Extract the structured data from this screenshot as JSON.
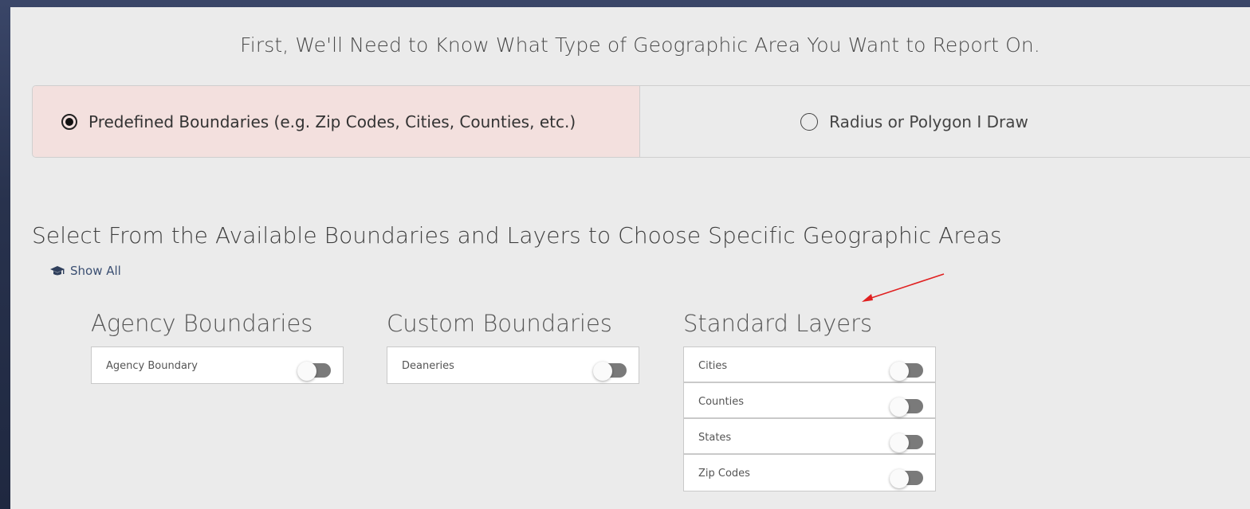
{
  "heading": "First, We'll Need to Know What Type of Geographic Area You Want to Report On.",
  "area_type": {
    "options": [
      {
        "label": "Predefined Boundaries (e.g. Zip Codes, Cities, Counties, etc.)",
        "selected": true
      },
      {
        "label": "Radius or Polygon I Draw",
        "selected": false
      }
    ]
  },
  "select_heading": "Select From the Available Boundaries and Layers to Choose Specific Geographic Areas",
  "show_all": {
    "icon": "graduation-cap-icon",
    "label": "Show All"
  },
  "groups": [
    {
      "title": "Agency Boundaries",
      "layers": [
        {
          "label": "Agency Boundary",
          "on": false
        }
      ]
    },
    {
      "title": "Custom Boundaries",
      "layers": [
        {
          "label": "Deaneries",
          "on": false
        }
      ]
    },
    {
      "title": "Standard Layers",
      "layers": [
        {
          "label": "Cities",
          "on": false
        },
        {
          "label": "Counties",
          "on": false
        },
        {
          "label": "States",
          "on": false
        },
        {
          "label": "Zip Codes",
          "on": false
        }
      ]
    }
  ],
  "colors": {
    "selected_option_bg": "#f3e0de",
    "panel_bg": "#ebebeb",
    "toggle_off_track": "#7a7a7a",
    "annotation_arrow": "#e02020",
    "link": "#3b4f72"
  }
}
